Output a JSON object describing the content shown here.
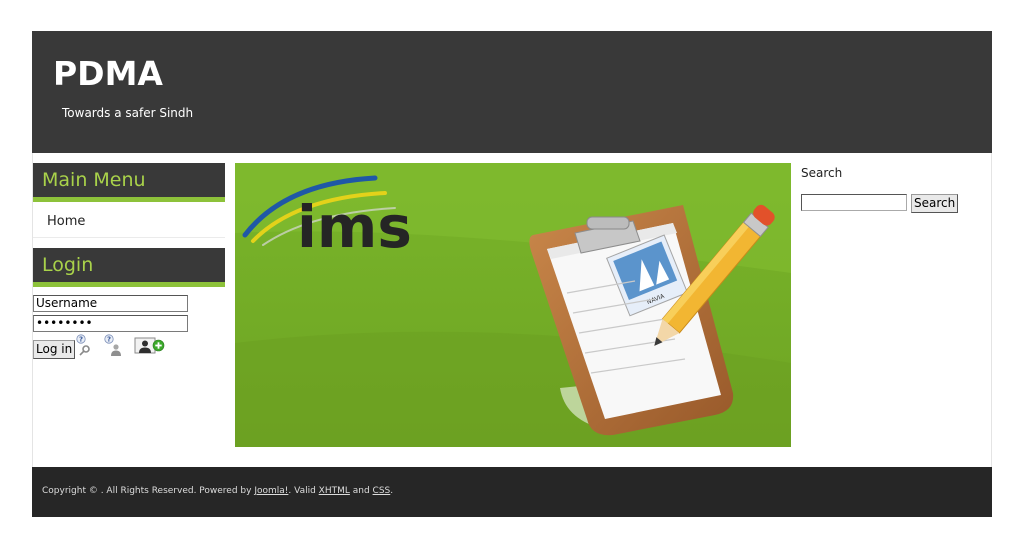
{
  "header": {
    "title": "PDMA",
    "tagline": "Towards a safer Sindh"
  },
  "main_menu": {
    "heading": "Main Menu",
    "items": [
      {
        "label": "Home"
      }
    ]
  },
  "login": {
    "heading": "Login",
    "username_value": "Username",
    "password_value": "password",
    "button_label": "Log in",
    "icons": [
      "forgot-password-icon",
      "forgot-username-icon",
      "register-icon"
    ]
  },
  "banner": {
    "logo_text": "ims",
    "clipboard_label": "NAVIA",
    "icons": [
      "clipboard-icon",
      "pencil-icon"
    ]
  },
  "search": {
    "label": "Search",
    "input_value": "",
    "button_label": "Search"
  },
  "footer": {
    "prefix": "Copyright © . All Rights Reserved. Powered by ",
    "joomla": "Joomla!",
    "mid": ". Valid ",
    "xhtml": "XHTML",
    "and": " and ",
    "css": "CSS",
    "suffix": "."
  },
  "colors": {
    "header_bg": "#393939",
    "footer_bg": "#262626",
    "accent_green": "#8dc23a",
    "module_title": "#a9d24a",
    "banner_green": "#7bb42a"
  }
}
